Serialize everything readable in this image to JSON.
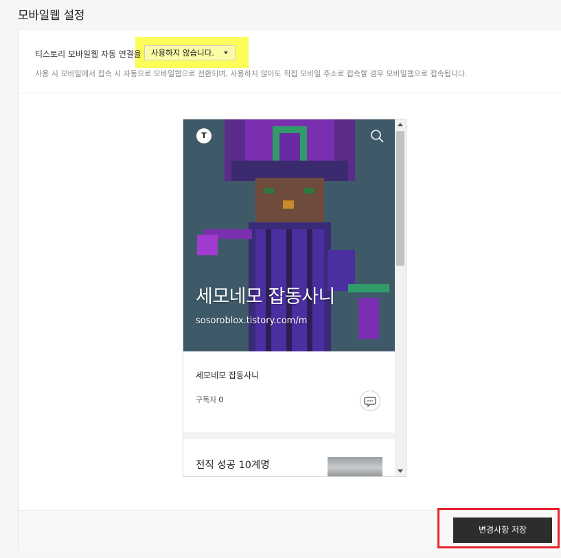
{
  "page": {
    "title": "모바일웹 설정"
  },
  "setting": {
    "label": "티스토리 모바일웹 자동 연결을",
    "select_value": "사용하지 않습니다.",
    "description": "사용 시 모바일에서 접속 시 자동으로 모바일웹으로 전환되며, 사용하지 않아도 직접 모바일 주소로 접속할 경우 모바일웹으로 접속됩니다."
  },
  "preview": {
    "logo_glyph": "T",
    "search_icon": "search-icon",
    "hero_title": "세모네모 잡동사니",
    "hero_url": "sosoroblox.tistory.com/m",
    "blog_name": "세모네모 잡동사니",
    "subscriber_label": "구독자",
    "subscriber_count": "0",
    "comment_icon": "speech-bubble-icon",
    "post_title": "전직 성공 10계명"
  },
  "footer": {
    "save_label": "변경사항 저장"
  },
  "colors": {
    "highlight": "#fdfd5a",
    "save_button": "#2d2d2d",
    "annotation_frame": "#e8222e"
  }
}
